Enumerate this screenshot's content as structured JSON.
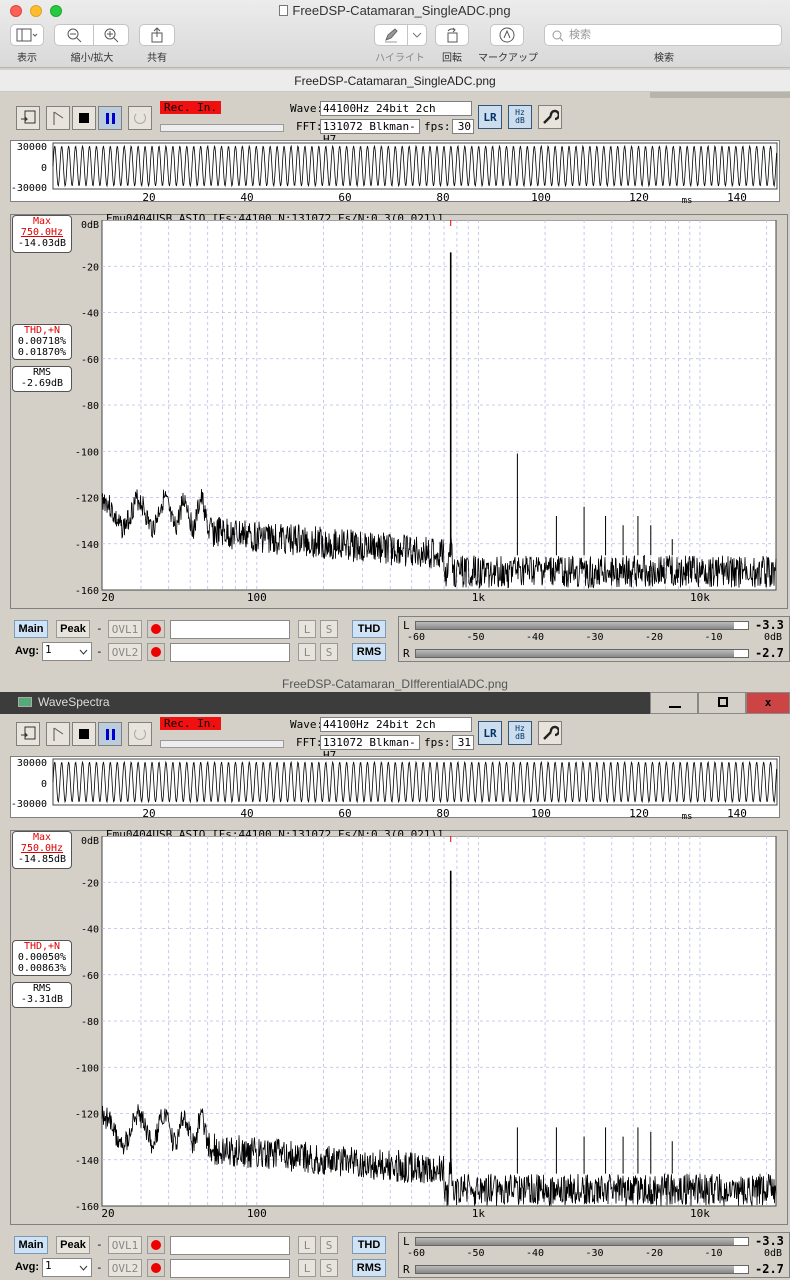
{
  "mac": {
    "window_title": "FreeDSP-Catamaran_SingleADC.png",
    "sidebar_label": "表示",
    "zoom_label": "縮小/拡大",
    "share_label": "共有",
    "highlight_label": "ハイライト",
    "rotate_label": "回転",
    "markup_label": "マークアップ",
    "search_label": "検索",
    "search_placeholder": "検索"
  },
  "doc1_title": "FreeDSP-Catamaran_SingleADC.png",
  "doc2_title": "FreeDSP-Catamaran_DIfferentialADC.png",
  "app2_title": "WaveSpectra",
  "panels": [
    {
      "rec_label": "Rec. In.",
      "wave_label": "Wave:",
      "wave": "44100Hz 24bit 2ch",
      "fft_label": "FFT:",
      "fft": "131072 Blkman-H7",
      "fps_label": "fps:",
      "fps": "30",
      "scope_y": [
        "30000",
        "0",
        "-30000"
      ],
      "scope_x": [
        "20",
        "40",
        "60",
        "80",
        "100",
        "120",
        "ms",
        "140"
      ],
      "device": "Emu0404USB ASIO",
      "params": "[Fs:44100 N:131072 Fs/N:0.3(0.021)]",
      "max_title": "Max",
      "max_freq": "750.0Hz",
      "max_db": "-14.03dB",
      "thd_title": "THD,+N",
      "thd": "0.00718%",
      "thdn": "0.01870%",
      "rms_title": "RMS",
      "rms": "-2.69dB",
      "y_ticks": [
        "0dB",
        "-20",
        "-40",
        "-60",
        "-80",
        "-100",
        "-120",
        "-140",
        "-160"
      ],
      "x_ticks": [
        "20",
        "100",
        "1k",
        "10k"
      ],
      "btn_main": "Main",
      "btn_peak": "Peak",
      "dash": "-",
      "ovl1": "OVL1",
      "ovl2": "OVL2",
      "avg_label": "Avg:",
      "avg": "1",
      "L": "L",
      "S": "S",
      "thd_btn": "THD",
      "rms_btn": "RMS",
      "meter_ticks": [
        "-60",
        "-50",
        "-40",
        "-30",
        "-20",
        "-10",
        "0dB"
      ],
      "meter_L": "L",
      "meter_R": "R",
      "level_L": "-3.3",
      "level_R": "-2.7"
    },
    {
      "rec_label": "Rec. In.",
      "wave_label": "Wave:",
      "wave": "44100Hz 24bit 2ch",
      "fft_label": "FFT:",
      "fft": "131072 Blkman-H7",
      "fps_label": "fps:",
      "fps": "31",
      "scope_y": [
        "30000",
        "0",
        "-30000"
      ],
      "scope_x": [
        "20",
        "40",
        "60",
        "80",
        "100",
        "120",
        "ms",
        "140"
      ],
      "device": "Emu0404USB ASIO",
      "params": "[Fs:44100 N:131072 Fs/N:0.3(0.021)]",
      "max_title": "Max",
      "max_freq": "750.0Hz",
      "max_db": "-14.85dB",
      "thd_title": "THD,+N",
      "thd": "0.00050%",
      "thdn": "0.00863%",
      "rms_title": "RMS",
      "rms": "-3.31dB",
      "y_ticks": [
        "0dB",
        "-20",
        "-40",
        "-60",
        "-80",
        "-100",
        "-120",
        "-140",
        "-160"
      ],
      "x_ticks": [
        "20",
        "100",
        "1k",
        "10k"
      ],
      "btn_main": "Main",
      "btn_peak": "Peak",
      "dash": "-",
      "ovl1": "OVL1",
      "ovl2": "OVL2",
      "avg_label": "Avg:",
      "avg": "1",
      "L": "L",
      "S": "S",
      "thd_btn": "THD",
      "rms_btn": "RMS",
      "meter_ticks": [
        "-60",
        "-50",
        "-40",
        "-30",
        "-20",
        "-10",
        "0dB"
      ],
      "meter_L": "L",
      "meter_R": "R",
      "level_L": "-3.3",
      "level_R": "-2.7"
    }
  ],
  "chart_data": [
    {
      "type": "line",
      "title": "",
      "xlabel": "",
      "ylabel": "",
      "x_scale": "log",
      "xlim": [
        20,
        22050
      ],
      "ylim": [
        -160,
        0
      ],
      "grid": true,
      "series": [
        {
          "peaks_hz": [
            750,
            1500,
            2250,
            3000,
            3750,
            4500,
            5250,
            6000,
            7500
          ],
          "peaks_db": [
            -14,
            -101,
            -128,
            -124,
            -128,
            -132,
            -128,
            -132,
            -138
          ],
          "noise_floor_db": -145
        }
      ]
    },
    {
      "type": "line",
      "title": "",
      "xlabel": "",
      "ylabel": "",
      "x_scale": "log",
      "xlim": [
        20,
        22050
      ],
      "ylim": [
        -160,
        0
      ],
      "grid": true,
      "series": [
        {
          "peaks_hz": [
            750,
            1500,
            2250,
            3000,
            3750,
            4500,
            5250,
            6000,
            7500
          ],
          "peaks_db": [
            -15,
            -126,
            -126,
            -130,
            -126,
            -130,
            -126,
            -128,
            -132
          ],
          "noise_floor_db": -146
        }
      ]
    }
  ]
}
